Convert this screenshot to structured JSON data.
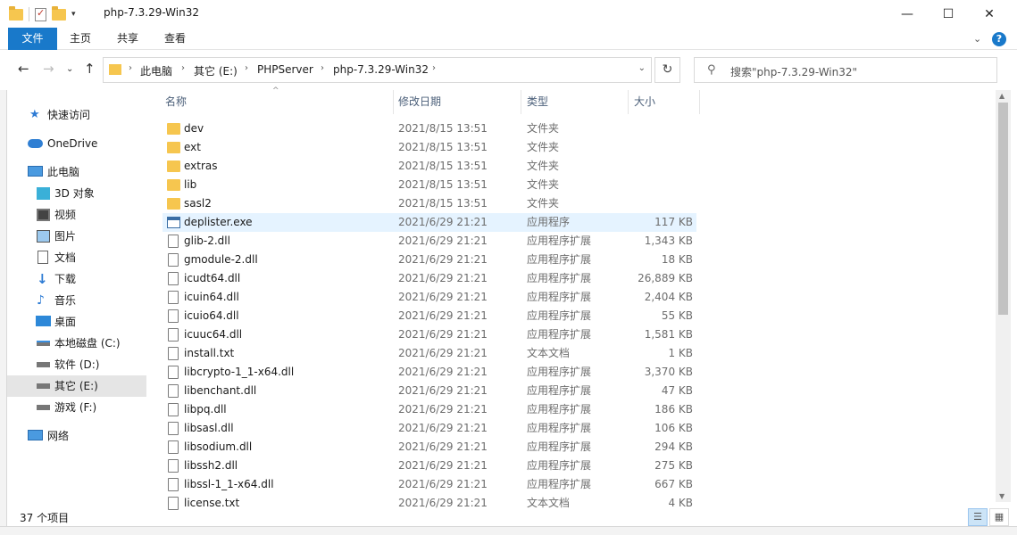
{
  "window": {
    "title": "php-7.3.29-Win32",
    "minimize": "—",
    "maximize": "☐",
    "close": "✕"
  },
  "ribbon": {
    "tabs": [
      "文件",
      "主页",
      "共享",
      "查看"
    ],
    "collapse": "⌄",
    "help": "?"
  },
  "address": {
    "breadcrumbs": [
      "此电脑",
      "其它 (E:)",
      "PHPServer",
      "php-7.3.29-Win32"
    ],
    "search_placeholder": "搜索\"php-7.3.29-Win32\""
  },
  "nav": {
    "items": [
      {
        "label": "快速访问",
        "icon": "star-icon"
      },
      {
        "label": "OneDrive",
        "icon": "cloud-icon"
      },
      {
        "label": "此电脑",
        "icon": "computer-icon"
      },
      {
        "label": "3D 对象",
        "icon": "cube-icon"
      },
      {
        "label": "视频",
        "icon": "video-icon"
      },
      {
        "label": "图片",
        "icon": "picture-icon"
      },
      {
        "label": "文档",
        "icon": "document-icon"
      },
      {
        "label": "下载",
        "icon": "download-icon"
      },
      {
        "label": "音乐",
        "icon": "music-icon"
      },
      {
        "label": "桌面",
        "icon": "desktop-icon"
      },
      {
        "label": "本地磁盘 (C:)",
        "icon": "drive-icon"
      },
      {
        "label": "软件 (D:)",
        "icon": "drive-icon"
      },
      {
        "label": "其它 (E:)",
        "icon": "drive-icon",
        "selected": true
      },
      {
        "label": "游戏 (F:)",
        "icon": "drive-icon"
      },
      {
        "label": "网络",
        "icon": "network-icon"
      }
    ]
  },
  "columns": {
    "name": "名称",
    "date": "修改日期",
    "type": "类型",
    "size": "大小"
  },
  "files": [
    {
      "name": "dev",
      "date": "2021/8/15 13:51",
      "type": "文件夹",
      "size": "",
      "kind": "folder"
    },
    {
      "name": "ext",
      "date": "2021/8/15 13:51",
      "type": "文件夹",
      "size": "",
      "kind": "folder"
    },
    {
      "name": "extras",
      "date": "2021/8/15 13:51",
      "type": "文件夹",
      "size": "",
      "kind": "folder"
    },
    {
      "name": "lib",
      "date": "2021/8/15 13:51",
      "type": "文件夹",
      "size": "",
      "kind": "folder"
    },
    {
      "name": "sasl2",
      "date": "2021/8/15 13:51",
      "type": "文件夹",
      "size": "",
      "kind": "folder"
    },
    {
      "name": "deplister.exe",
      "date": "2021/6/29 21:21",
      "type": "应用程序",
      "size": "117 KB",
      "kind": "exe",
      "highlighted": true
    },
    {
      "name": "glib-2.dll",
      "date": "2021/6/29 21:21",
      "type": "应用程序扩展",
      "size": "1,343 KB",
      "kind": "file"
    },
    {
      "name": "gmodule-2.dll",
      "date": "2021/6/29 21:21",
      "type": "应用程序扩展",
      "size": "18 KB",
      "kind": "file"
    },
    {
      "name": "icudt64.dll",
      "date": "2021/6/29 21:21",
      "type": "应用程序扩展",
      "size": "26,889 KB",
      "kind": "file"
    },
    {
      "name": "icuin64.dll",
      "date": "2021/6/29 21:21",
      "type": "应用程序扩展",
      "size": "2,404 KB",
      "kind": "file"
    },
    {
      "name": "icuio64.dll",
      "date": "2021/6/29 21:21",
      "type": "应用程序扩展",
      "size": "55 KB",
      "kind": "file"
    },
    {
      "name": "icuuc64.dll",
      "date": "2021/6/29 21:21",
      "type": "应用程序扩展",
      "size": "1,581 KB",
      "kind": "file"
    },
    {
      "name": "install.txt",
      "date": "2021/6/29 21:21",
      "type": "文本文档",
      "size": "1 KB",
      "kind": "file"
    },
    {
      "name": "libcrypto-1_1-x64.dll",
      "date": "2021/6/29 21:21",
      "type": "应用程序扩展",
      "size": "3,370 KB",
      "kind": "file"
    },
    {
      "name": "libenchant.dll",
      "date": "2021/6/29 21:21",
      "type": "应用程序扩展",
      "size": "47 KB",
      "kind": "file"
    },
    {
      "name": "libpq.dll",
      "date": "2021/6/29 21:21",
      "type": "应用程序扩展",
      "size": "186 KB",
      "kind": "file"
    },
    {
      "name": "libsasl.dll",
      "date": "2021/6/29 21:21",
      "type": "应用程序扩展",
      "size": "106 KB",
      "kind": "file"
    },
    {
      "name": "libsodium.dll",
      "date": "2021/6/29 21:21",
      "type": "应用程序扩展",
      "size": "294 KB",
      "kind": "file"
    },
    {
      "name": "libssh2.dll",
      "date": "2021/6/29 21:21",
      "type": "应用程序扩展",
      "size": "275 KB",
      "kind": "file"
    },
    {
      "name": "libssl-1_1-x64.dll",
      "date": "2021/6/29 21:21",
      "type": "应用程序扩展",
      "size": "667 KB",
      "kind": "file"
    },
    {
      "name": "license.txt",
      "date": "2021/6/29 21:21",
      "type": "文本文档",
      "size": "4 KB",
      "kind": "file"
    }
  ],
  "status": {
    "item_count": "37 个项目"
  },
  "colors": {
    "accent": "#1979ca",
    "hover_row": "#e5f3ff",
    "selected_nav": "#e5e5e5",
    "header_text": "#4c607a"
  }
}
